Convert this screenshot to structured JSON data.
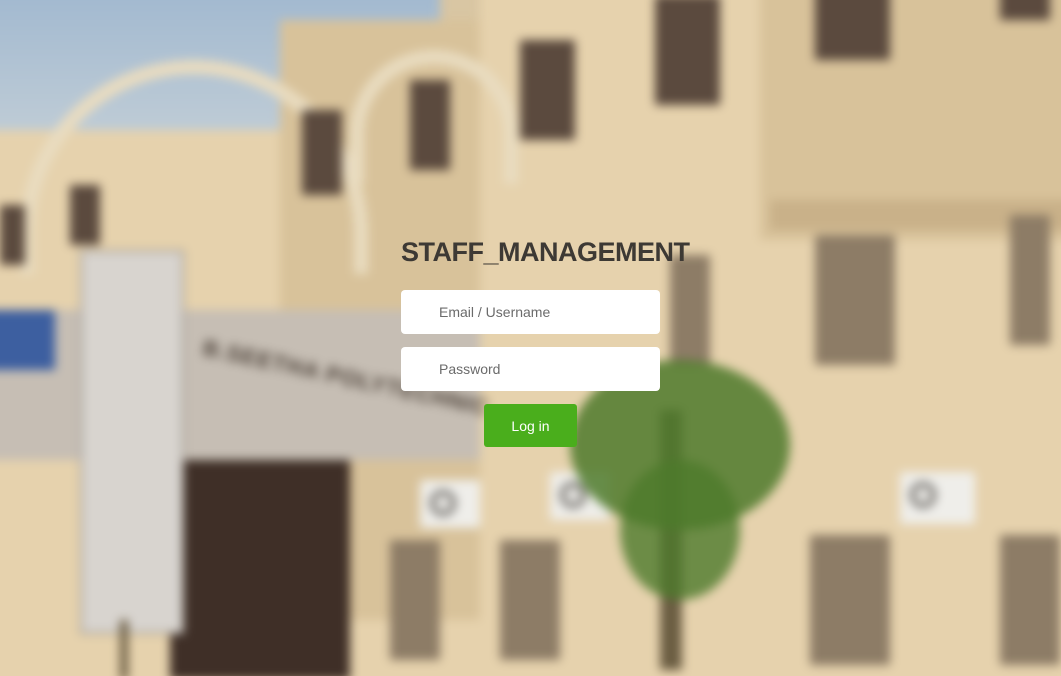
{
  "login": {
    "title": "STAFF_MANAGEMENT",
    "email_placeholder": "Email / Username",
    "password_placeholder": "Password",
    "login_button": "Log in"
  },
  "background": {
    "sign_text": "B.SEETHA POLYTECHNIC",
    "colors": {
      "button": "#4aae1c",
      "title": "#3d3934",
      "building": "#e6d2ad"
    }
  }
}
